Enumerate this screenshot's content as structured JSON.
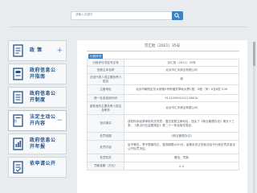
{
  "search": {
    "placeholder": "请输入关键字"
  },
  "sidebar": {
    "items": [
      {
        "label": "政 策",
        "badge": ""
      },
      {
        "label": "政府信息公开指南",
        "badge": ""
      },
      {
        "label": "政府信息公开制度",
        "badge": ""
      },
      {
        "label": "法定主动公开内容",
        "badge": "总"
      },
      {
        "label": "政府信息公开年报",
        "badge": ""
      },
      {
        "label": "依申请公开",
        "badge": ""
      }
    ]
  },
  "document": {
    "number": "京汇批〔2021〕35号",
    "tag": "行政许可",
    "rows": [
      {
        "key": "行政许可决定书文号",
        "value": "京汇批〔2021〕35号",
        "align": "center"
      },
      {
        "key": "违规主体名称",
        "value": "北京市汇丰典当有限公司",
        "align": "center"
      },
      {
        "key": "法定代表人或主要负责人姓名",
        "value": "谢",
        "align": "center"
      },
      {
        "key": "注册地址",
        "value": "北京市朝阳区东大桥路9号侨福芳草地大厦C座、D座（甲）6至8层 C06",
        "align": "center"
      },
      {
        "key": "统一社会信用代码",
        "value": "91110000102113861K",
        "align": "center"
      },
      {
        "key": "被批准的主要负责人姓名及职务",
        "value": "北京市汇丰典当有限公司",
        "align": "center"
      },
      {
        "key": "违法事实",
        "value": "该机构未经原审批机关同意，擅自变更注册地址，违反了《典当管理办法》第五十三条、《典当行业监管规定》第二十一条及相关规定。",
        "align": "left"
      },
      {
        "key": "处罚依据",
        "value": "《典当管理办法》",
        "align": "center"
      },
      {
        "key": "处罚内容",
        "value": "给予警告，责令限期改正。整改期限为30日，逾期未改正的依法给予行政处罚并依法公开处罚决定。",
        "align": "left"
      },
      {
        "key": "处罚机关",
        "value": "警告、罚款",
        "align": "center"
      },
      {
        "key": "罚款金额（万元）",
        "value": "0.5",
        "align": "center"
      }
    ]
  }
}
